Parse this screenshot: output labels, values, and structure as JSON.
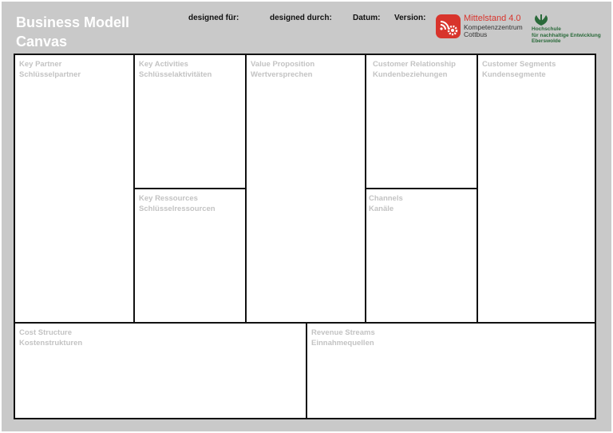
{
  "header": {
    "title_line1": "Business Modell",
    "title_line2": "Canvas",
    "designed_for": "designed für:",
    "designed_by": "designed durch:",
    "date": "Datum:",
    "version": "Version:"
  },
  "logos": {
    "mittelstand_title": "Mittelstand 4.0",
    "mittelstand_sub1": "Kompetenzzentrum",
    "mittelstand_sub2": "Cottbus",
    "hnee_line1": "Hochschule",
    "hnee_line2": "für nachhaltige Entwicklung",
    "hnee_line3": "Eberswolde",
    "colors": {
      "mittelstand_red": "#d8342c",
      "hnee_green": "#2a6a3a"
    }
  },
  "blocks": {
    "key_partner": {
      "en": "Key Partner",
      "de": "Schlüsselpartner"
    },
    "key_activities": {
      "en": "Key Activities",
      "de": "Schlüsselaktivitäten"
    },
    "key_resources": {
      "en": "Key Ressources",
      "de": "Schlüsselressourcen"
    },
    "value_proposition": {
      "en": "Value Proposition",
      "de": "Wertversprechen"
    },
    "customer_relationship": {
      "en": "Customer Relationship",
      "de": "Kundenbeziehungen"
    },
    "channels": {
      "en": "Channels",
      "de": "Kanäle"
    },
    "customer_segments": {
      "en": "Customer Segments",
      "de": "Kundensegmente"
    },
    "cost_structure": {
      "en": "Cost Structure",
      "de": "Kostenstrukturen"
    },
    "revenue_streams": {
      "en": "Revenue Streams",
      "de": "Einnahmequellen"
    }
  }
}
